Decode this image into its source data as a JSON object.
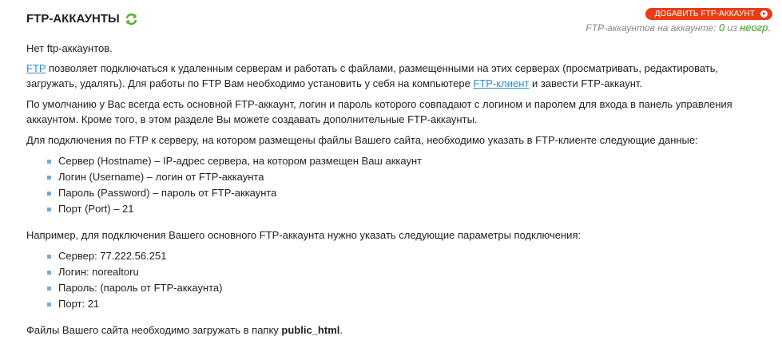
{
  "header": {
    "title": "FTP-АККАУНТЫ",
    "refresh_icon": "refresh-icon",
    "add_button_label": "ДОБАВИТЬ FTP-АККАУНТ",
    "count_prefix": "FTP-аккаунтов на аккаунте:",
    "count_value": "0",
    "count_sep": "из",
    "count_limit": "неогр."
  },
  "content": {
    "no_accounts": "Нет ftp-аккаунтов.",
    "p2_link": "FTP",
    "p2_text_a": " позволяет подключаться к удаленным серверам и работать с файлами, размещенными на этих серверах (просматривать, редактировать, загружать, удалять). Для работы по FTP Вам необходимо установить у себя на компьютере ",
    "p2_link2": "FTP-клиент",
    "p2_text_b": " и завести FTP-аккаунт.",
    "p3": "По умолчанию у Вас всегда есть основной FTP-аккаунт, логин и пароль которого совпадают с логином и паролем для входа в панель управления аккаунтом. Кроме того, в этом разделе Вы можете создавать дополнительные FTP-аккаунты.",
    "p4": "Для подключения по FTP к серверу, на котором размещены файлы Вашего сайта, необходимо указать в FTP-клиенте следующие данные:",
    "list1": [
      "Сервер (Hostname) – IP-адрес сервера, на котором размещен Ваш аккаунт",
      "Логин (Username) – логин от FTP-аккаунта",
      "Пароль (Password) – пароль от FTP-аккаунта",
      "Порт (Port) – 21"
    ],
    "p5": "Например, для подключения Вашего основного FTP-аккаунта нужно указать следующие параметры подключения:",
    "list2": [
      "Сервер: 77.222.56.251",
      "Логин: norealtoru",
      "Пароль: (пароль от FTP-аккаунта)",
      "Порт: 21"
    ],
    "p6_text": "Файлы Вашего сайта необходимо загружать в папку ",
    "p6_bold": "public_html",
    "p6_end": "."
  }
}
